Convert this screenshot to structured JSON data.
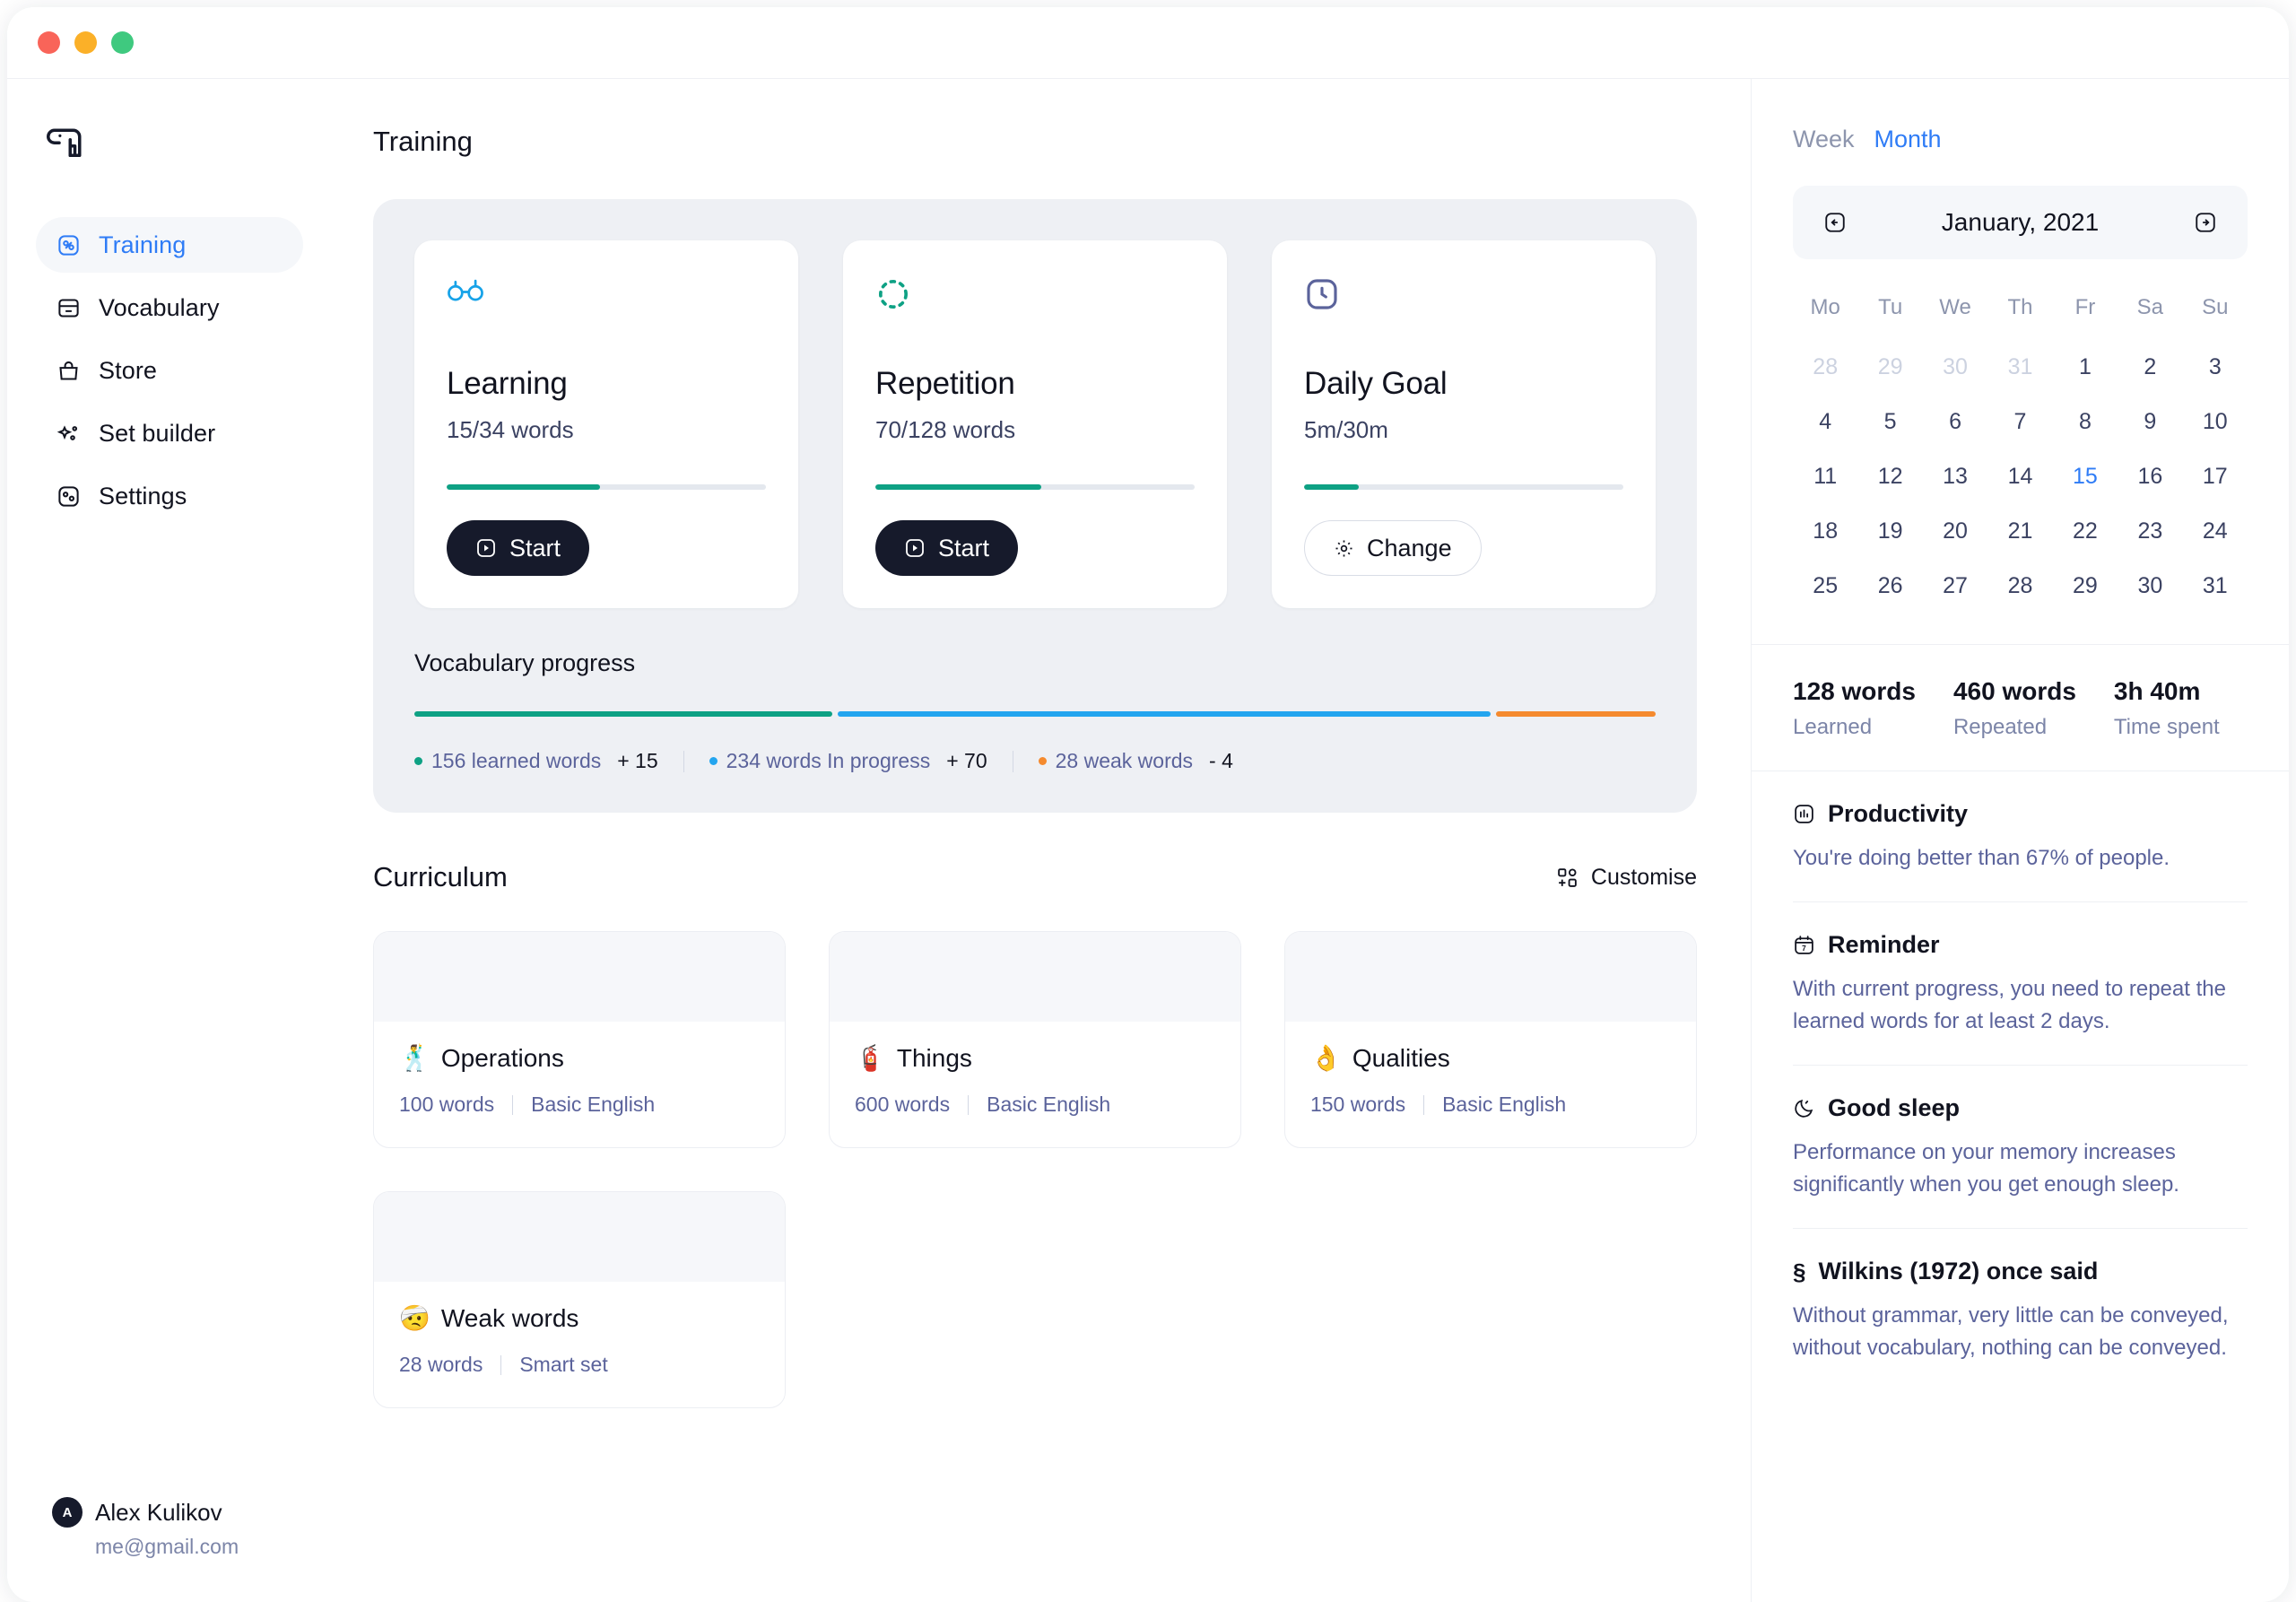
{
  "window": {
    "controls": [
      "close",
      "minimize",
      "maximize"
    ]
  },
  "brand": {
    "logo_icon": "parrot-logo-icon"
  },
  "sidebar": {
    "items": [
      {
        "label": "Training",
        "icon": "training-icon",
        "active": true
      },
      {
        "label": "Vocabulary",
        "icon": "vocabulary-icon",
        "active": false
      },
      {
        "label": "Store",
        "icon": "store-bag-icon",
        "active": false
      },
      {
        "label": "Set builder",
        "icon": "sparkles-icon",
        "active": false
      },
      {
        "label": "Settings",
        "icon": "settings-icon",
        "active": false
      }
    ],
    "user": {
      "name": "Alex Kulikov",
      "email": "me@gmail.com",
      "initial": "A"
    }
  },
  "main": {
    "training_title": "Training",
    "cards": [
      {
        "icon": "glasses-icon",
        "icon_color": "#16a2e8",
        "title": "Learning",
        "sub": "15/34 words",
        "progress": 48,
        "button": {
          "label": "Start",
          "icon": "play-icon",
          "style": "dark"
        }
      },
      {
        "icon": "dotted-circle-icon",
        "icon_color": "#0ea184",
        "title": "Repetition",
        "sub": "70/128 words",
        "progress": 52,
        "button": {
          "label": "Start",
          "icon": "play-icon",
          "style": "dark"
        }
      },
      {
        "icon": "clock-icon",
        "icon_color": "#5b639b",
        "title": "Daily Goal",
        "sub": "5m/30m",
        "progress": 17,
        "button": {
          "label": "Change",
          "icon": "gear-icon",
          "style": "ghost"
        }
      }
    ],
    "vocabulary_progress": {
      "title": "Vocabulary progress",
      "segments": [
        {
          "label": "156 learned words",
          "delta": "+ 15",
          "color": "#0ea184",
          "share": 34
        },
        {
          "label": "234 words In progress",
          "delta": "+ 70",
          "color": "#23a5ef",
          "share": 53
        },
        {
          "label": "28 weak words",
          "delta": "- 4",
          "color": "#f58a2e",
          "share": 13
        }
      ]
    },
    "curriculum": {
      "title": "Curriculum",
      "customise_label": "Customise",
      "customise_icon": "customise-grid-icon",
      "cards": [
        {
          "emoji": "🕺",
          "title": "Operations",
          "words": "100 words",
          "level": "Basic English"
        },
        {
          "emoji": "🧯",
          "title": "Things",
          "words": "600 words",
          "level": "Basic English"
        },
        {
          "emoji": "👌",
          "title": "Qualities",
          "words": "150 words",
          "level": "Basic English"
        },
        {
          "emoji": "🤕",
          "title": "Weak words",
          "words": "28 words",
          "level": "Smart set"
        }
      ]
    }
  },
  "rail": {
    "tabs": [
      {
        "label": "Week",
        "active": false
      },
      {
        "label": "Month",
        "active": true
      }
    ],
    "calendar": {
      "month": "January, 2021",
      "prev_icon": "arrow-left-box-icon",
      "next_icon": "arrow-right-box-icon",
      "dow": [
        "Mo",
        "Tu",
        "We",
        "Th",
        "Fr",
        "Sa",
        "Su"
      ],
      "weeks": [
        [
          {
            "d": "28",
            "mut": true
          },
          {
            "d": "29",
            "mut": true
          },
          {
            "d": "30",
            "mut": true
          },
          {
            "d": "31",
            "mut": true
          },
          {
            "d": "1"
          },
          {
            "d": "2"
          },
          {
            "d": "3"
          }
        ],
        [
          {
            "d": "4"
          },
          {
            "d": "5"
          },
          {
            "d": "6"
          },
          {
            "d": "7"
          },
          {
            "d": "8"
          },
          {
            "d": "9"
          },
          {
            "d": "10"
          }
        ],
        [
          {
            "d": "11"
          },
          {
            "d": "12"
          },
          {
            "d": "13"
          },
          {
            "d": "14"
          },
          {
            "d": "15",
            "sel": true
          },
          {
            "d": "16"
          },
          {
            "d": "17"
          }
        ],
        [
          {
            "d": "18"
          },
          {
            "d": "19"
          },
          {
            "d": "20"
          },
          {
            "d": "21"
          },
          {
            "d": "22"
          },
          {
            "d": "23"
          },
          {
            "d": "24"
          }
        ],
        [
          {
            "d": "25"
          },
          {
            "d": "26"
          },
          {
            "d": "27"
          },
          {
            "d": "28"
          },
          {
            "d": "29"
          },
          {
            "d": "30"
          },
          {
            "d": "31"
          }
        ]
      ]
    },
    "stats": [
      {
        "value": "128 words",
        "label": "Learned"
      },
      {
        "value": "460 words",
        "label": "Repeated"
      },
      {
        "value": "3h 40m",
        "label": "Time spent"
      }
    ],
    "tips": [
      {
        "icon": "chart-bars-icon",
        "title": "Productivity",
        "body": "You're doing better than 67% of people."
      },
      {
        "icon": "calendar-icon",
        "title": "Reminder",
        "body": "With current progress, you need to repeat the learned words for at least 2 days."
      },
      {
        "icon": "moon-icon",
        "title": "Good sleep",
        "body": "Performance on your memory increases significantly when you get enough sleep."
      },
      {
        "icon": "section-icon",
        "title": "Wilkins (1972) once said",
        "body": "Without grammar, very little can be conveyed, without vocabulary, nothing can be conveyed."
      }
    ]
  },
  "colors": {
    "accent": "#2f7cf6",
    "green": "#0ea184",
    "blue": "#23a5ef",
    "orange": "#f58a2e",
    "dark": "#161a2b"
  }
}
